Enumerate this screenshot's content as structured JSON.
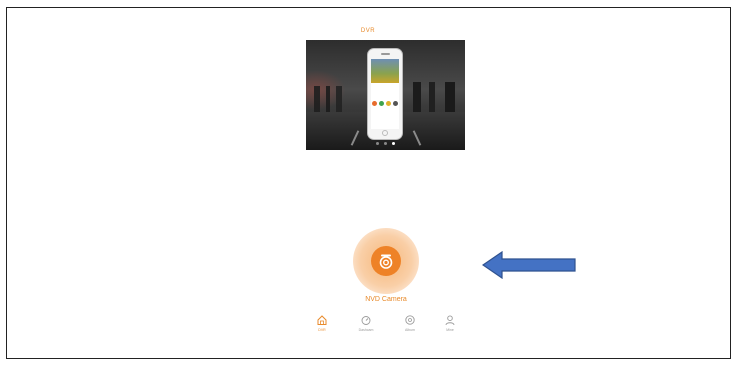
{
  "app": {
    "title": "DVR"
  },
  "banner": {
    "slide_count": 3,
    "active_slide": 3
  },
  "camera": {
    "label": "NVD Camera"
  },
  "tabs": [
    {
      "label": "DVR",
      "icon": "home-icon",
      "active": true
    },
    {
      "label": "Dashcam",
      "icon": "dashboard-icon",
      "active": false
    },
    {
      "label": "Album",
      "icon": "album-icon",
      "active": false
    },
    {
      "label": "Mine",
      "icon": "user-icon",
      "active": false
    }
  ],
  "colors": {
    "accent": "#ee8227",
    "arrow": "#4472c4",
    "arrow_border": "#2f528f"
  }
}
